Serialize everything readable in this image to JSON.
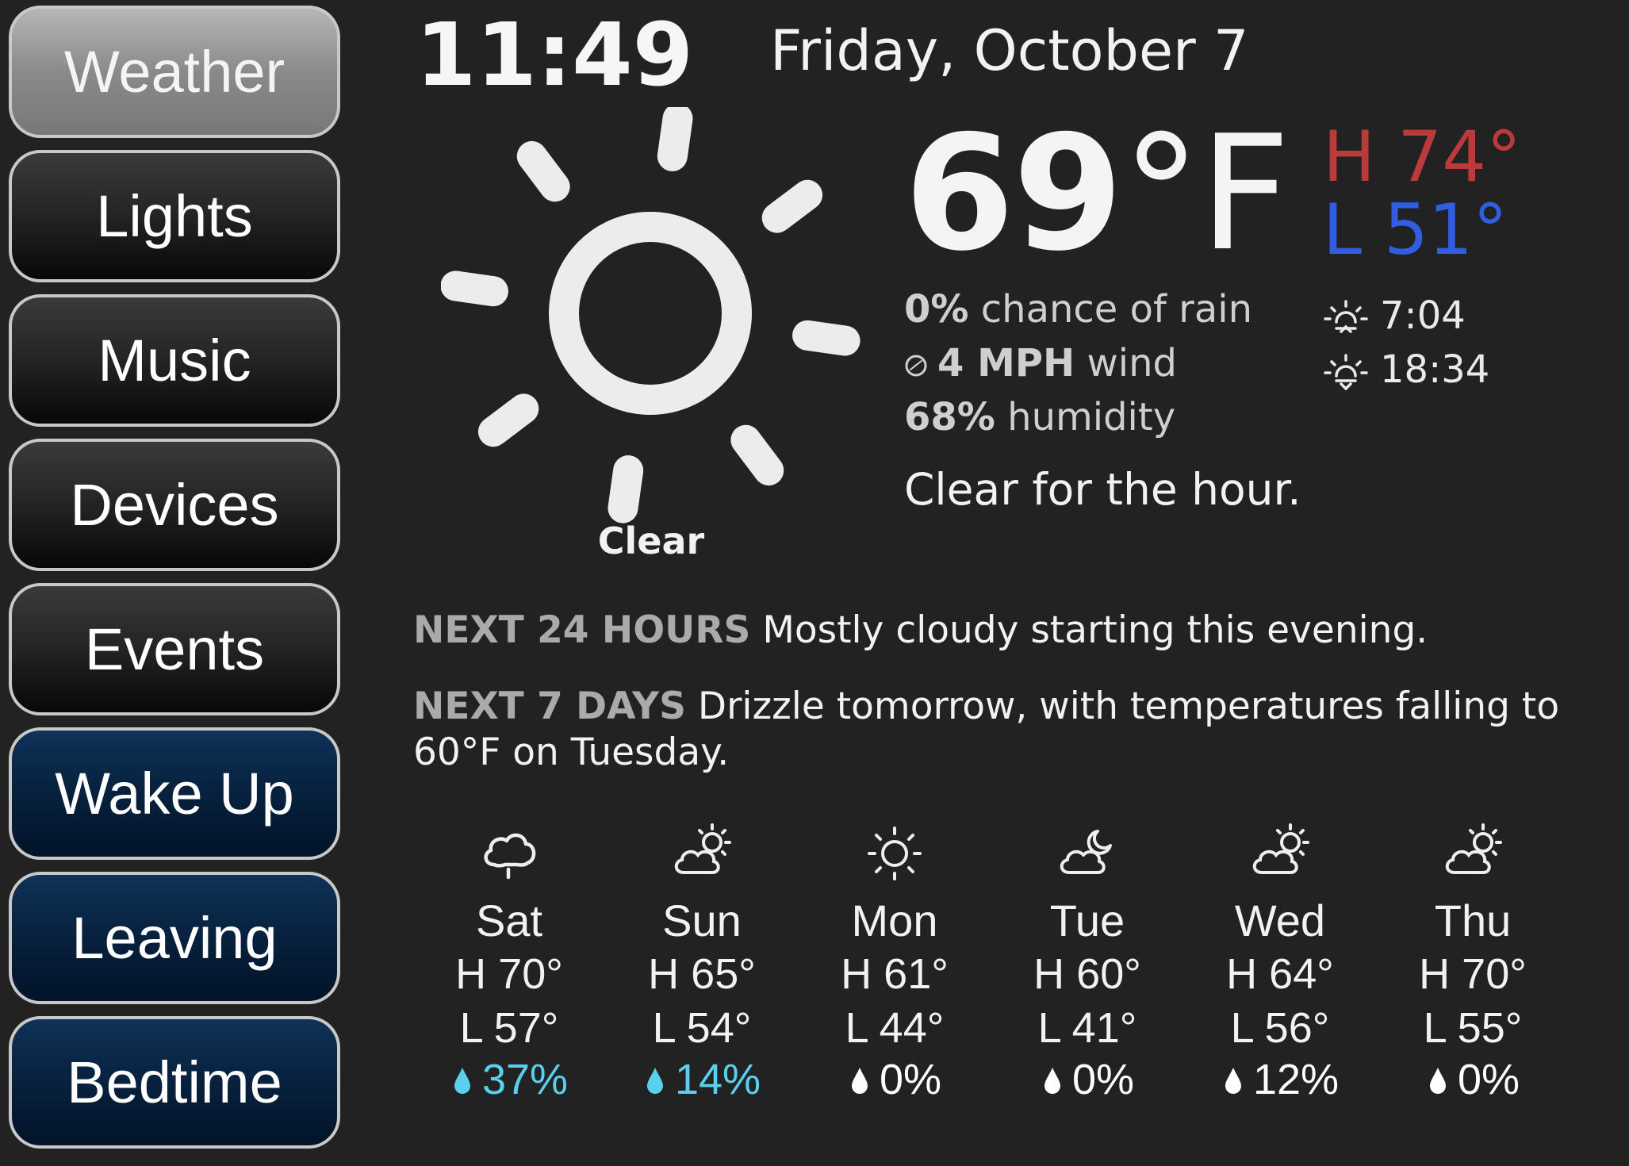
{
  "sidebar": {
    "items": [
      {
        "label": "Weather"
      },
      {
        "label": "Lights"
      },
      {
        "label": "Music"
      },
      {
        "label": "Devices"
      },
      {
        "label": "Events"
      },
      {
        "label": "Wake Up"
      },
      {
        "label": "Leaving"
      },
      {
        "label": "Bedtime"
      }
    ],
    "active": "Weather"
  },
  "header": {
    "time": "11:49",
    "date": "Friday, October 7"
  },
  "current": {
    "icon": "clear-day-sun-icon",
    "condition": "Clear",
    "temperature": "69",
    "unit": "°F",
    "high": "H 74°",
    "low": "L 51°",
    "rain_value": "0%",
    "rain_label": " chance of rain",
    "wind_value": "4 MPH",
    "wind_label": " wind",
    "humidity_value": "68%",
    "humidity_label": " humidity",
    "sunrise": "7:04",
    "sunset": "18:34",
    "hour_summary": "Clear for the hour.",
    "colors": {
      "high": "#bb3a3a",
      "low": "#2f5fe0",
      "rain_accent": "#58d0ee"
    }
  },
  "outlook": {
    "next24_label": "NEXT 24 HOURS",
    "next24_text": " Mostly cloudy starting this evening.",
    "next7_label": "NEXT 7 DAYS",
    "next7_text": " Drizzle tomorrow, with temperatures falling to 60°F on Tuesday."
  },
  "forecast": [
    {
      "day": "Sat",
      "icon": "rain-cloud-icon",
      "high": "H 70°",
      "low": "L 57°",
      "precip": "37%"
    },
    {
      "day": "Sun",
      "icon": "partly-cloudy-day-icon",
      "high": "H 65°",
      "low": "L 54°",
      "precip": "14%"
    },
    {
      "day": "Mon",
      "icon": "clear-day-icon",
      "high": "H 61°",
      "low": "L 44°",
      "precip": "0%"
    },
    {
      "day": "Tue",
      "icon": "partly-cloudy-night-icon",
      "high": "H 60°",
      "low": "L 41°",
      "precip": "0%"
    },
    {
      "day": "Wed",
      "icon": "partly-cloudy-day-icon",
      "high": "H 64°",
      "low": "L 56°",
      "precip": "12%"
    },
    {
      "day": "Thu",
      "icon": "partly-cloudy-day-icon",
      "high": "H 70°",
      "low": "L 55°",
      "precip": "0%"
    }
  ]
}
